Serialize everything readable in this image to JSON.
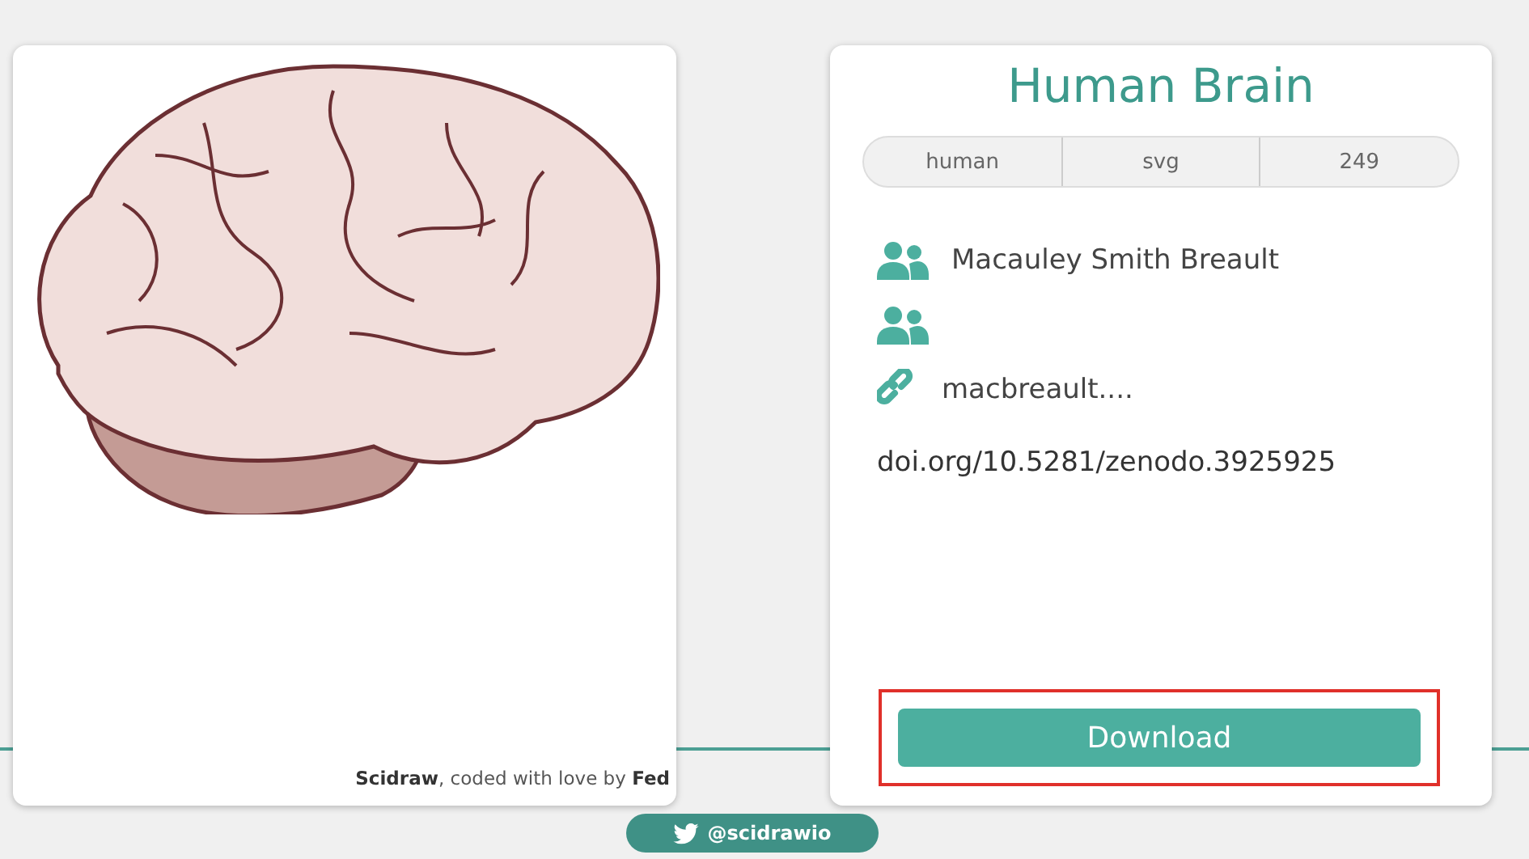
{
  "preview": {
    "footer_credit": "**Scidraw**, coded with love by **Fed**"
  },
  "details": {
    "title": "Human Brain",
    "tags": [
      "human",
      "svg",
      "249"
    ],
    "info_rows": [
      {
        "kind": "people",
        "text": "Macauley Smith Breault"
      },
      {
        "kind": "people"
      },
      {
        "kind": "link",
        "text": "macbreault...."
      }
    ],
    "doi": "doi.org/10.5281/zenodo.3925925",
    "download_button": "Download",
    "download_highlighted": true
  },
  "twitter_button": "@scidrawio"
}
